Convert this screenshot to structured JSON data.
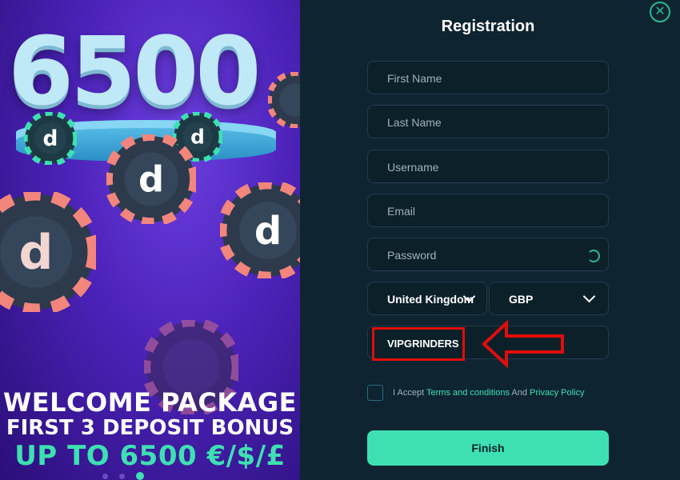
{
  "promo": {
    "amount": "6500",
    "line1": "WELCOME PACKAGE",
    "line2": "FIRST 3 DEPOSIT BONUS",
    "line3": "UP TO 6500 €/$/£",
    "accent_color": "#3ee0b2"
  },
  "registration": {
    "title": "Registration",
    "close_icon": "close-icon",
    "fields": {
      "first_name": {
        "placeholder": "First Name"
      },
      "last_name": {
        "placeholder": "Last Name"
      },
      "username": {
        "placeholder": "Username"
      },
      "email": {
        "placeholder": "Email"
      },
      "password": {
        "placeholder": "Password",
        "icon": "eye-icon"
      }
    },
    "country": {
      "value": "United Kingdom"
    },
    "currency": {
      "value": "GBP"
    },
    "promo_code": {
      "value": "VIPGRINDERS"
    },
    "consent": {
      "prefix": "I Accept",
      "terms": "Terms and conditions",
      "and": "And",
      "privacy": "Privacy Policy"
    },
    "finish_label": "Finish",
    "colors": {
      "panel": "#0e2430",
      "accent": "#3ee0b2",
      "annotation": "#e10d0d"
    }
  }
}
